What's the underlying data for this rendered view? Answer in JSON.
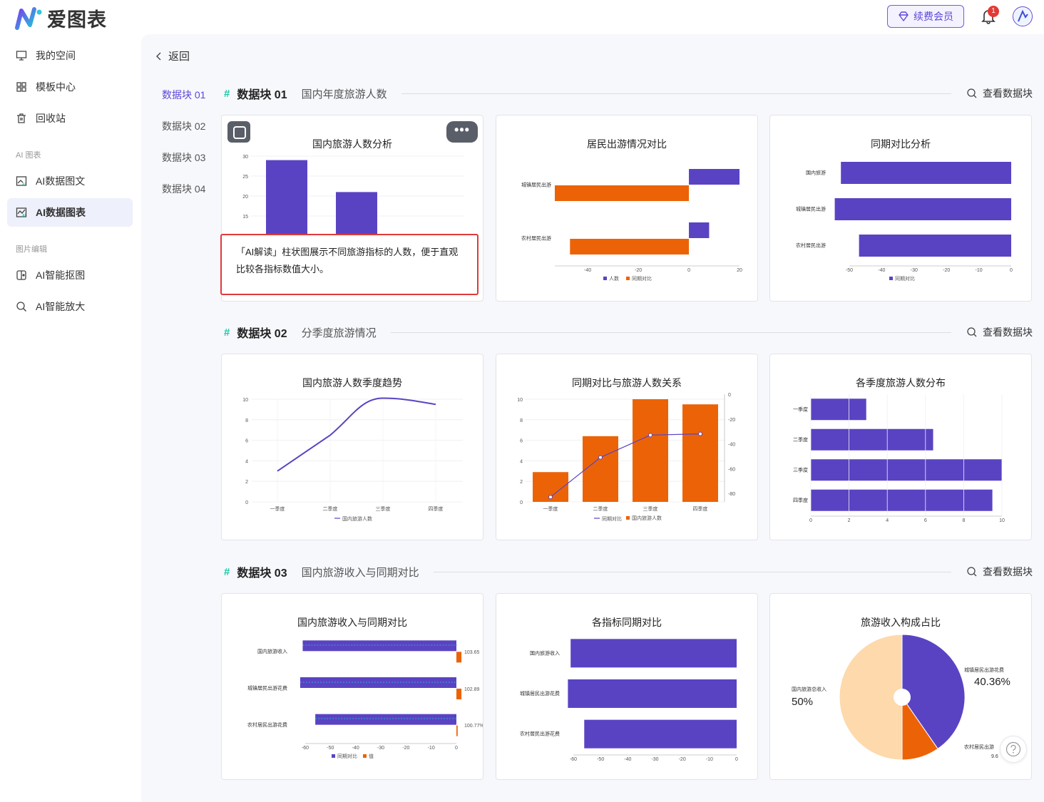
{
  "app": {
    "logo_text": "爱图表"
  },
  "header": {
    "vip_label": "续费会员",
    "notification_count": "1"
  },
  "sidebar": {
    "items": [
      {
        "label": "我的空间",
        "icon": "monitor-icon"
      },
      {
        "label": "模板中心",
        "icon": "grid-icon"
      },
      {
        "label": "回收站",
        "icon": "trash-icon"
      }
    ],
    "group_ai": "AI 图表",
    "ai_items": [
      {
        "label": "AI数据图文",
        "icon": "image-ai-icon"
      },
      {
        "label": "AI数据图表",
        "icon": "chart-ai-icon",
        "active": true
      }
    ],
    "group_image": "图片编辑",
    "image_items": [
      {
        "label": "AI智能抠图",
        "icon": "cutout-icon"
      },
      {
        "label": "AI智能放大",
        "icon": "zoom-icon"
      }
    ]
  },
  "main": {
    "back_label": "返回",
    "nav": [
      "数据块 01",
      "数据块 02",
      "数据块 03",
      "数据块 04"
    ],
    "view_label": "查看数据块",
    "ai_reading": "「AI解读」柱状图展示不同旅游指标的人数，便于直观比较各指标数值大小。",
    "sections": [
      {
        "hash": "#",
        "name": "数据块 01",
        "subtitle": "国内年度旅游人数"
      },
      {
        "hash": "#",
        "name": "数据块 02",
        "subtitle": "分季度旅游情况"
      },
      {
        "hash": "#",
        "name": "数据块 03",
        "subtitle": "国内旅游收入与同期对比"
      }
    ]
  },
  "colors": {
    "purple": "#5a43c3",
    "orange": "#ec6307",
    "peach": "#fdd9ac",
    "accent": "#5b48d9",
    "teal": "#1fc7a8"
  },
  "chart_data": [
    {
      "type": "bar",
      "title": "国内旅游人数分析",
      "yticks": [
        "30",
        "25",
        "20",
        "15"
      ],
      "ylim": [
        0,
        30
      ],
      "values": [
        29,
        21
      ]
    },
    {
      "type": "bar",
      "title": "居民出游情况对比",
      "orientation": "horizontal",
      "categories": [
        "城镇居民出游",
        "农村居民出游"
      ],
      "series": [
        {
          "name": "人数",
          "values": [
            20,
            8
          ]
        },
        {
          "name": "同期对比",
          "values": [
            -53,
            -47
          ]
        }
      ],
      "xticks": [
        "-40",
        "-20",
        "0",
        "20"
      ]
    },
    {
      "type": "bar",
      "title": "同期对比分析",
      "orientation": "horizontal",
      "categories": [
        "国内旅游",
        "城镇居民出游",
        "农村居民出游"
      ],
      "series": [
        {
          "name": "同期对比",
          "values": [
            -52.6,
            -54.5,
            -47
          ]
        }
      ],
      "xticks": [
        "-50",
        "-40",
        "-30",
        "-20",
        "-10",
        "0"
      ]
    },
    {
      "type": "line",
      "title": "国内旅游人数季度趋势",
      "categories": [
        "一季度",
        "二季度",
        "三季度",
        "四季度"
      ],
      "yticks": [
        "10",
        "8",
        "6",
        "4",
        "2",
        "0"
      ],
      "series": [
        {
          "name": "国内旅游人数",
          "values": [
            3,
            6.5,
            10.1,
            9.5
          ]
        }
      ]
    },
    {
      "type": "bar",
      "title": "同期对比与旅游人数关系",
      "categories": [
        "一季度",
        "二季度",
        "三季度",
        "四季度"
      ],
      "yticks": [
        "10",
        "8",
        "6",
        "4",
        "2",
        "0"
      ],
      "y2ticks": [
        "0",
        "-20",
        "-40",
        "-60",
        "-80"
      ],
      "series": [
        {
          "name": "同期对比",
          "type": "line",
          "values": [
            -83,
            -51,
            -33,
            -32
          ]
        },
        {
          "name": "国内旅游人数",
          "type": "bar",
          "values": [
            2.9,
            6.4,
            10,
            9.5
          ]
        }
      ]
    },
    {
      "type": "bar",
      "title": "各季度旅游人数分布",
      "orientation": "horizontal",
      "categories": [
        "一季度",
        "二季度",
        "三季度",
        "四季度"
      ],
      "values": [
        2.9,
        6.4,
        10,
        9.5
      ],
      "xticks": [
        "0",
        "2",
        "4",
        "6",
        "8",
        "10"
      ]
    },
    {
      "type": "bar",
      "title": "国内旅游收入与同期对比",
      "orientation": "horizontal",
      "categories": [
        "国内旅游收入",
        "城镇居民出游花费",
        "农村居民出游花费"
      ],
      "series": [
        {
          "name": "同期对比",
          "values": [
            -61,
            -62,
            -56
          ]
        },
        {
          "name": "值",
          "values": [
            2,
            2,
            0.5
          ]
        }
      ],
      "labels": [
        "103.65",
        "102.89",
        "100.77%"
      ],
      "xticks": [
        "-60",
        "-50",
        "-40",
        "-30",
        "-20",
        "-10",
        "0"
      ]
    },
    {
      "type": "bar",
      "title": "各指标同期对比",
      "orientation": "horizontal",
      "categories": [
        "国内旅游收入",
        "城镇居民出游花费",
        "农村居民出游花费"
      ],
      "values": [
        -61,
        -62,
        -56
      ],
      "xticks": [
        "-60",
        "-50",
        "-40",
        "-30",
        "-20",
        "-10",
        "0"
      ]
    },
    {
      "type": "pie",
      "title": "旅游收入构成占比",
      "slices": [
        {
          "label": "城镇居民出游花费",
          "value": 40.36,
          "display": "40.36%"
        },
        {
          "label": "农村居民出游",
          "value": 9.64,
          "display": "9.6"
        },
        {
          "label": "国内旅游总收入",
          "value": 50,
          "display": "50%"
        }
      ]
    }
  ]
}
